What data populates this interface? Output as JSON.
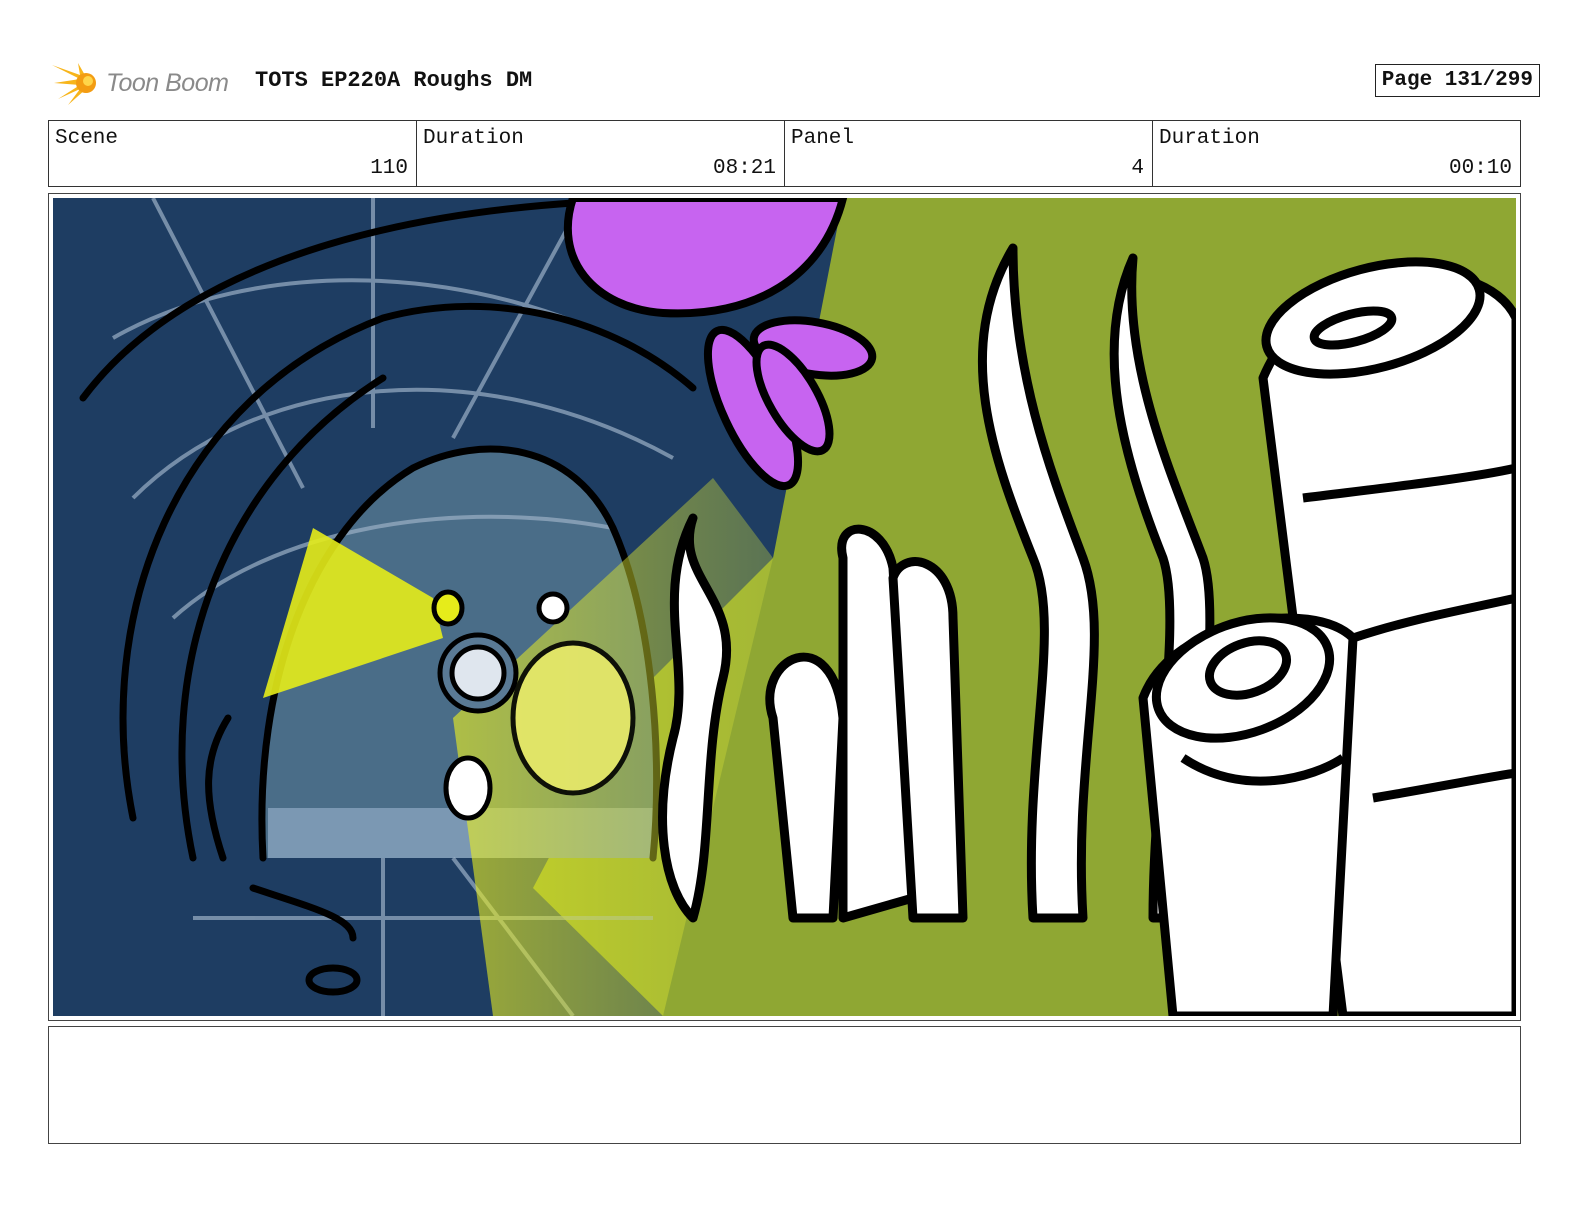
{
  "header": {
    "logo_text": "Toon Boom",
    "title": "TOTS EP220A Roughs DM",
    "page": "Page 131/299"
  },
  "info": {
    "scene_label": "Scene",
    "scene_value": "110",
    "scene_duration_label": "Duration",
    "scene_duration_value": "08:21",
    "panel_label": "Panel",
    "panel_value": "4",
    "panel_duration_label": "Duration",
    "panel_duration_value": "00:10"
  },
  "colors": {
    "tunnel_blue": "#1e3d62",
    "inner_blue": "#4a6d88",
    "floor_blue": "#7b98b3",
    "coral_green": "#8fa733",
    "purple": "#c764f0",
    "flashlight_yellow": "#e6ec1a",
    "logo_orange": "#f7a21b"
  },
  "notes": {
    "text": ""
  }
}
